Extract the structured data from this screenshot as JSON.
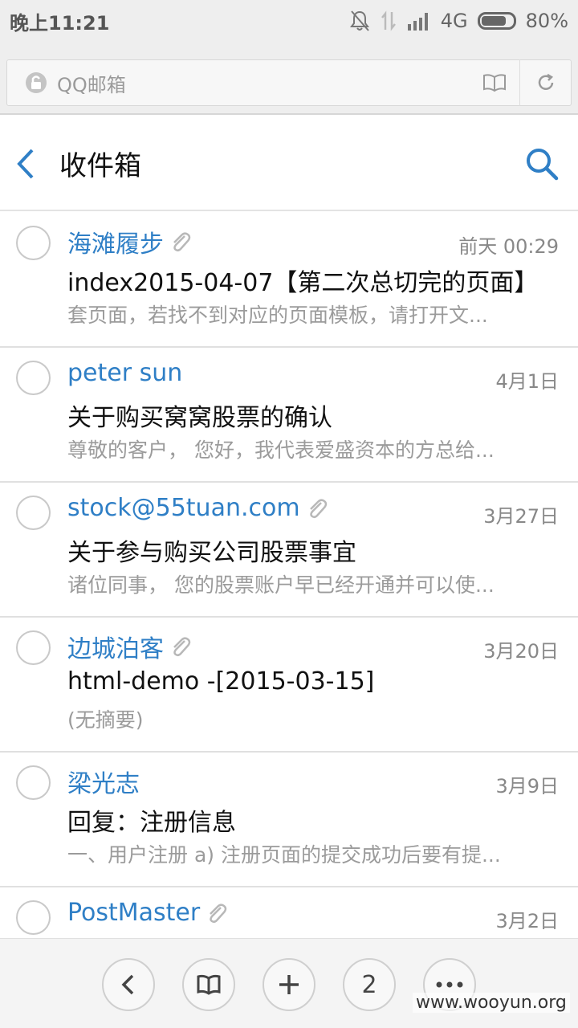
{
  "status_bar": {
    "time": "晚上11:21",
    "network": "4G",
    "battery": "80%",
    "battery_level": 0.8
  },
  "browser": {
    "site_title": "QQ邮箱"
  },
  "header": {
    "title": "收件箱"
  },
  "mails": [
    {
      "sender": "海滩履步",
      "has_attachment": true,
      "date": "前天 00:29",
      "subject": "index2015-04-07【第二次总切完的页面】",
      "summary": "套页面，若找不到对应的页面模板，请打开文..."
    },
    {
      "sender": "peter sun",
      "has_attachment": false,
      "date": "4月1日",
      "subject": "关于购买窝窝股票的确认",
      "summary": "尊敬的客户， 您好，我代表爱盛资本的方总给..."
    },
    {
      "sender": "stock@55tuan.com",
      "has_attachment": true,
      "date": "3月27日",
      "subject": "关于参与购买公司股票事宜",
      "summary": "诸位同事， 您的股票账户早已经开通并可以使..."
    },
    {
      "sender": "边城泊客",
      "has_attachment": true,
      "date": "3月20日",
      "subject": "html-demo -[2015-03-15]",
      "summary": "(无摘要)"
    },
    {
      "sender": "梁光志",
      "has_attachment": false,
      "date": "3月9日",
      "subject": "回复：注册信息",
      "summary": "一、用户注册 a) 注册页面的提交成功后要有提..."
    },
    {
      "sender": "PostMaster",
      "has_attachment": true,
      "date": "3月2日",
      "subject": "",
      "summary": ""
    }
  ],
  "toolbar": {
    "tabs_count": "2"
  },
  "watermark": "www.wooyun.org",
  "colors": {
    "accent": "#2f7fc6",
    "status_bg": "#eeeeee"
  }
}
